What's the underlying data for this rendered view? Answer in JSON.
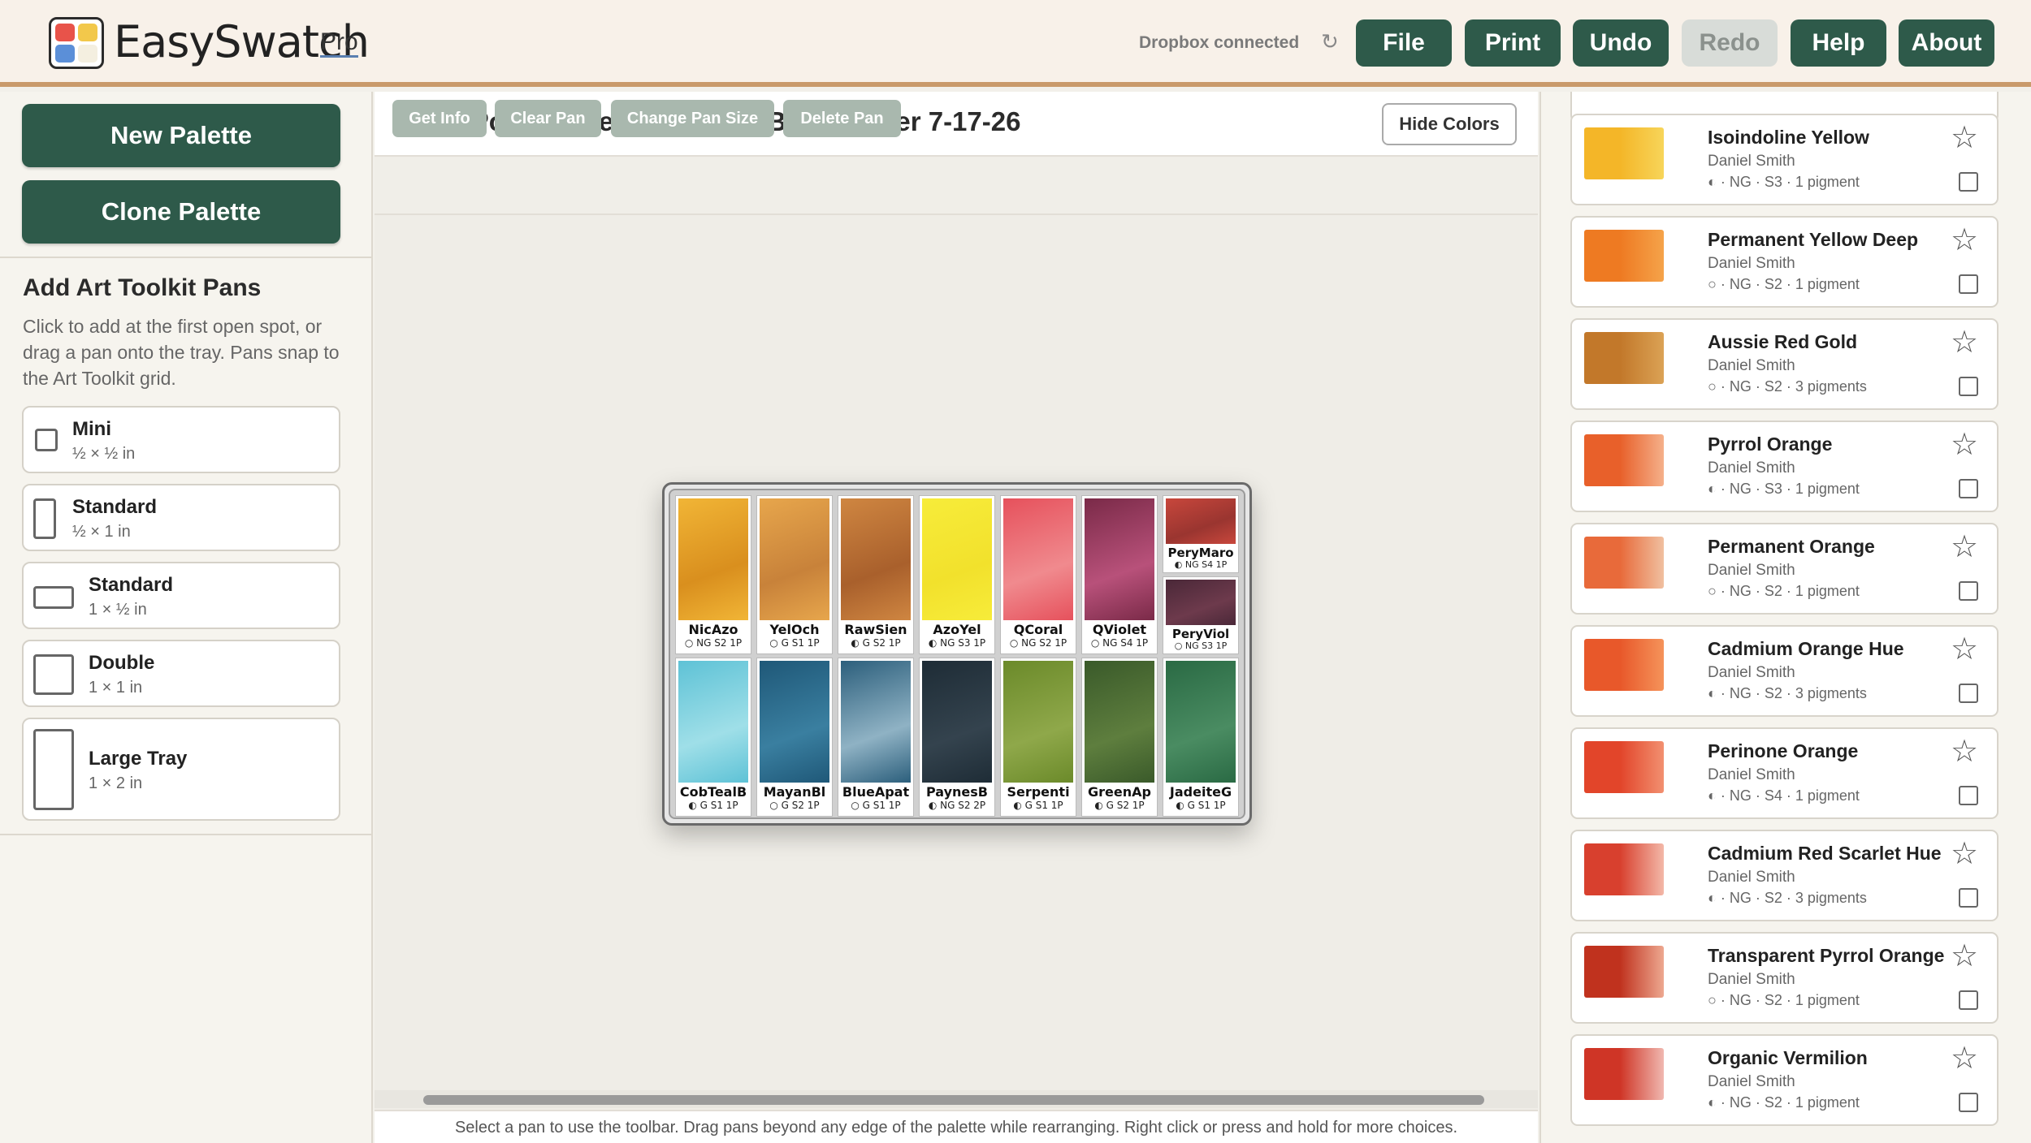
{
  "header": {
    "logo_text": "EasySwatch",
    "logo_badge": "Pro",
    "logo_colors": [
      "#e8534a",
      "#f2c84b",
      "#5b8fd8",
      "#f4efe0"
    ],
    "dropbox_status": "Dropbox connected",
    "buttons": [
      {
        "label": "File",
        "enabled": true
      },
      {
        "label": "Print",
        "enabled": true
      },
      {
        "label": "Undo",
        "enabled": true
      },
      {
        "label": "Redo",
        "enabled": false
      },
      {
        "label": "Help",
        "enabled": true
      },
      {
        "label": "About",
        "enabled": true
      }
    ]
  },
  "left": {
    "new_palette": "New Palette",
    "clone_palette": "Clone Palette",
    "section_title": "Add Art Toolkit Pans",
    "section_desc": "Click to add at the first open spot, or drag a pan onto the tray. Pans snap to the Art Toolkit grid.",
    "tools": [
      {
        "name": "Mini",
        "size": "½ × ½ in"
      },
      {
        "name": "Standard",
        "size": "½ × 1 in"
      },
      {
        "name": "Standard",
        "size": "1 × ½ in"
      },
      {
        "name": "Double",
        "size": "1 × 1 in"
      },
      {
        "name": "Large Tray",
        "size": "1 × 2 in"
      }
    ]
  },
  "center": {
    "palette_title": "Extra Pocket - Yel, Org, Erth, Blues Water 7-17-26",
    "hide_colors": "Hide Colors",
    "toolbar": [
      "Get Info",
      "Clear Pan",
      "Change Pan Size",
      "Delete Pan"
    ],
    "status": "Select a pan to use the toolbar. Drag pans beyond any edge of the palette while rearranging. Right click or press and hold for more choices."
  },
  "tray": {
    "pans": [
      {
        "name": "NicAzo",
        "meta": "○ NG S2 1P",
        "color": "#f1b536",
        "color2": "#d98f1e"
      },
      {
        "name": "YelOch",
        "meta": "○ G S1 1P",
        "color": "#e7a64c",
        "color2": "#c8823a"
      },
      {
        "name": "RawSien",
        "meta": "◐ G S2 1P",
        "color": "#cf8641",
        "color2": "#a9602c"
      },
      {
        "name": "AzoYel",
        "meta": "◐ NG S3 1P",
        "color": "#f7ec3a",
        "color2": "#f2e12c"
      },
      {
        "name": "QCoral",
        "meta": "○ NG S2 1P",
        "color": "#e6515c",
        "color2": "#f08a8e"
      },
      {
        "name": "QViolet",
        "meta": "○ NG S4 1P",
        "color": "#7a2a48",
        "color2": "#b8517a"
      },
      {
        "name": "PeryMaro",
        "meta": "◐ NG S4 1P",
        "color": "#c8473c",
        "color2": "#9a3530"
      },
      {
        "name": "PeryViol",
        "meta": "○ NG S3 1P",
        "color": "#4a2838",
        "color2": "#6d3a4c"
      },
      {
        "name": "CobTealB",
        "meta": "◐ G S1 1P",
        "color": "#5ec2d6",
        "color2": "#9fdfe8"
      },
      {
        "name": "MayanBl",
        "meta": "○ G S2 1P",
        "color": "#1f5878",
        "color2": "#3a7fa0"
      },
      {
        "name": "BlueApat",
        "meta": "○ G S1 1P",
        "color": "#2c5f7c",
        "color2": "#8fb2c4"
      },
      {
        "name": "PaynesB",
        "meta": "◐ NG S2 2P",
        "color": "#1e2c36",
        "color2": "#34434e"
      },
      {
        "name": "Serpenti",
        "meta": "◐ G S1 1P",
        "color": "#6b8a2a",
        "color2": "#8fa84a"
      },
      {
        "name": "GreenAp",
        "meta": "◐ G S2 1P",
        "color": "#3a5a2a",
        "color2": "#5e7e3e"
      },
      {
        "name": "JadeiteG",
        "meta": "◐ G S1 1P",
        "color": "#2a6a44",
        "color2": "#4a8c62"
      }
    ]
  },
  "colors": [
    {
      "name": "Isoindoline Yellow",
      "brand": "Daniel Smith",
      "meta": "◐ · NG · S3 · 1 pigment",
      "c1": "#f4b628",
      "c2": "#f7d55a"
    },
    {
      "name": "Permanent Yellow Deep",
      "brand": "Daniel Smith",
      "meta": "○ · NG · S2 · 1 pigment",
      "c1": "#ee7a22",
      "c2": "#f5a34a"
    },
    {
      "name": "Aussie Red Gold",
      "brand": "Daniel Smith",
      "meta": "○ · NG · S2 · 3 pigments",
      "c1": "#c2782a",
      "c2": "#dba255"
    },
    {
      "name": "Pyrrol Orange",
      "brand": "Daniel Smith",
      "meta": "◐ · NG · S3 · 1 pigment",
      "c1": "#e8602a",
      "c2": "#f5b08a"
    },
    {
      "name": "Permanent Orange",
      "brand": "Daniel Smith",
      "meta": "○ · NG · S2 · 1 pigment",
      "c1": "#e86a3a",
      "c2": "#f0c0a0"
    },
    {
      "name": "Cadmium Orange Hue",
      "brand": "Daniel Smith",
      "meta": "◐ · NG · S2 · 3 pigments",
      "c1": "#e8582a",
      "c2": "#f5935a"
    },
    {
      "name": "Perinone Orange",
      "brand": "Daniel Smith",
      "meta": "◐ · NG · S4 · 1 pigment",
      "c1": "#e2452a",
      "c2": "#f29070"
    },
    {
      "name": "Cadmium Red Scarlet Hue",
      "brand": "Daniel Smith",
      "meta": "◐ · NG · S2 · 3 pigments",
      "c1": "#d8402e",
      "c2": "#f3b8a8"
    },
    {
      "name": "Transparent Pyrrol Orange",
      "brand": "Daniel Smith",
      "meta": "○ · NG · S2 · 1 pigment",
      "c1": "#c0321e",
      "c2": "#eda890"
    },
    {
      "name": "Organic Vermilion",
      "brand": "Daniel Smith",
      "meta": "◐ · NG · S2 · 1 pigment",
      "c1": "#cf3526",
      "c2": "#f0b8b0"
    }
  ]
}
